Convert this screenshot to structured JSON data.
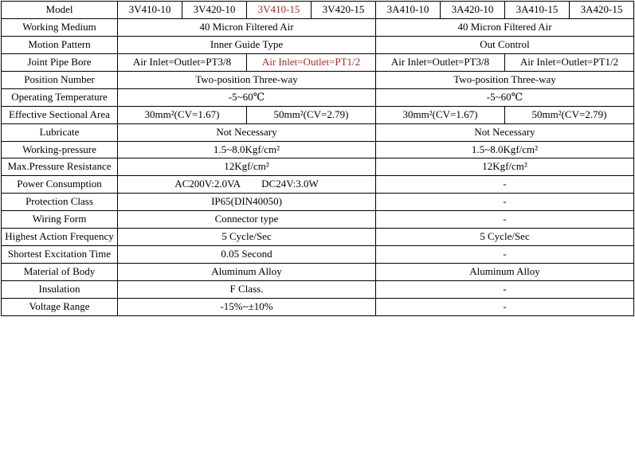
{
  "table": {
    "accent_color": "#9e2b23",
    "border_color": "#000000",
    "rows": [
      {
        "label": "Model",
        "cells": [
          {
            "text": "3V410-10",
            "highlight": false
          },
          {
            "text": "3V420-10",
            "highlight": false
          },
          {
            "text": "3V410-15",
            "highlight": true
          },
          {
            "text": "3V420-15",
            "highlight": false
          },
          {
            "text": "3A410-10",
            "highlight": false
          },
          {
            "text": "3A420-10",
            "highlight": false
          },
          {
            "text": "3A410-15",
            "highlight": false
          },
          {
            "text": "3A420-15",
            "highlight": false
          }
        ]
      },
      {
        "label": "Working Medium",
        "cells": [
          {
            "text": "40 Micron Filtered Air",
            "highlight": false
          },
          {
            "text": "40 Micron Filtered Air",
            "highlight": false
          }
        ]
      },
      {
        "label": "Motion Pattern",
        "cells": [
          {
            "text": "Inner Guide Type",
            "highlight": false
          },
          {
            "text": "Out Control",
            "highlight": false
          }
        ]
      },
      {
        "label": "Joint Pipe Bore",
        "cells": [
          {
            "text": "Air Inlet=Outlet=PT3/8",
            "highlight": false
          },
          {
            "text": "Air Inlet=Outlet=PT1/2",
            "highlight": true
          },
          {
            "text": "Air Inlet=Outlet=PT3/8",
            "highlight": false
          },
          {
            "text": "Air Inlet=Outlet=PT1/2",
            "highlight": false
          }
        ]
      },
      {
        "label": "Position Number",
        "cells": [
          {
            "text": "Two-position Three-way",
            "highlight": false
          },
          {
            "text": "Two-position Three-way",
            "highlight": false
          }
        ]
      },
      {
        "label": "Operating Temperature",
        "cells": [
          {
            "text": "-5~60℃",
            "highlight": false
          },
          {
            "text": "-5~60℃",
            "highlight": false
          }
        ]
      },
      {
        "label": "Effective Sectional Area",
        "cells": [
          {
            "text": "30mm²(CV=1.67)",
            "highlight": false
          },
          {
            "text": "50mm²(CV=2.79)",
            "highlight": false
          },
          {
            "text": "30mm²(CV=1.67)",
            "highlight": false
          },
          {
            "text": "50mm²(CV=2.79)",
            "highlight": false
          }
        ]
      },
      {
        "label": "Lubricate",
        "cells": [
          {
            "text": "Not Necessary",
            "highlight": false
          },
          {
            "text": "Not Necessary",
            "highlight": false
          }
        ]
      },
      {
        "label": "Working-pressure",
        "cells": [
          {
            "text": "1.5~8.0Kgf/cm²",
            "highlight": false
          },
          {
            "text": "1.5~8.0Kgf/cm²",
            "highlight": false
          }
        ]
      },
      {
        "label": "Max.Pressure Resistance",
        "cells": [
          {
            "text": "12Kgf/cm²",
            "highlight": false
          },
          {
            "text": "12Kgf/cm²",
            "highlight": false
          }
        ]
      },
      {
        "label": "Power Consumption",
        "cells": [
          {
            "text": "AC200V:2.0VA  DC24V:3.0W",
            "highlight": false
          },
          {
            "text": "-",
            "highlight": false
          }
        ]
      },
      {
        "label": "Protection Class",
        "cells": [
          {
            "text": "IP65(DIN40050)",
            "highlight": false
          },
          {
            "text": "-",
            "highlight": false
          }
        ]
      },
      {
        "label": "Wiring Form",
        "cells": [
          {
            "text": "Connector type",
            "highlight": false
          },
          {
            "text": "-",
            "highlight": false
          }
        ]
      },
      {
        "label": "Highest Action Frequency",
        "cells": [
          {
            "text": "5 Cycle/Sec",
            "highlight": false
          },
          {
            "text": "5 Cycle/Sec",
            "highlight": false
          }
        ]
      },
      {
        "label": "Shortest Excitation Time",
        "cells": [
          {
            "text": "0.05 Second",
            "highlight": false
          },
          {
            "text": "-",
            "highlight": false
          }
        ]
      },
      {
        "label": "Material of Body",
        "cells": [
          {
            "text": "Aluminum Alloy",
            "highlight": false
          },
          {
            "text": "Aluminum Alloy",
            "highlight": false
          }
        ]
      },
      {
        "label": "Insulation",
        "cells": [
          {
            "text": "F Class.",
            "highlight": false
          },
          {
            "text": "-",
            "highlight": false
          }
        ]
      },
      {
        "label": "Voltage Range",
        "cells": [
          {
            "text": "-15%~±10%",
            "highlight": false
          },
          {
            "text": "-",
            "highlight": false
          }
        ]
      }
    ]
  }
}
